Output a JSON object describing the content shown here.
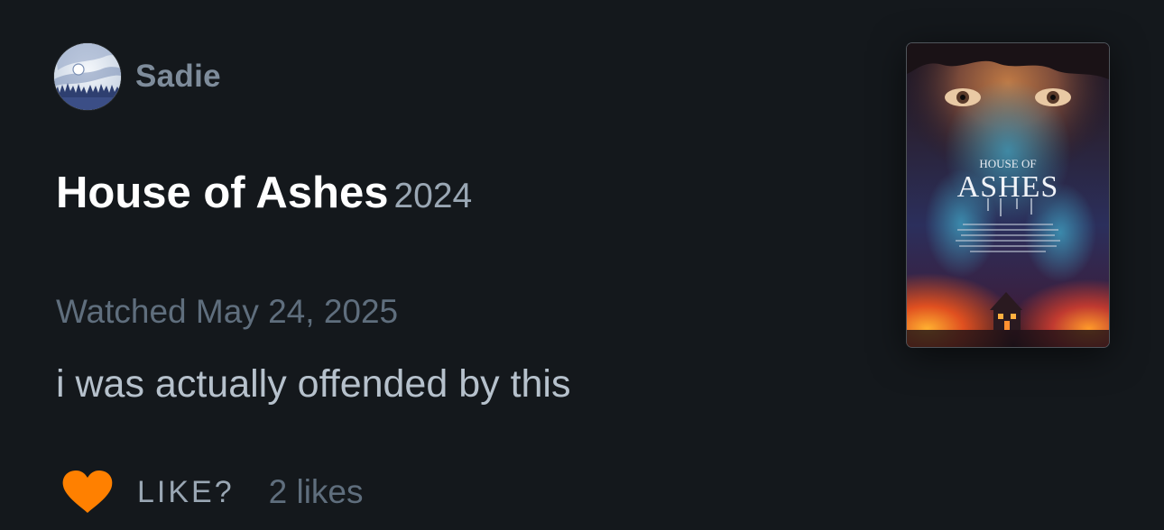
{
  "review": {
    "author": {
      "username": "Sadie",
      "avatar_icon": "avatar-moon-forest"
    },
    "film": {
      "title": "House of Ashes",
      "year": "2024",
      "poster": {
        "title_line1": "HOUSE OF",
        "title_line2": "ASHES"
      }
    },
    "watched": "Watched May 24, 2025",
    "text": "i was actually offended by this",
    "like": {
      "icon": "heart-icon",
      "icon_color": "#ff8000",
      "label": "LIKE?",
      "count": "2 likes"
    }
  },
  "colors": {
    "background": "#14181c",
    "username": "#7e8c9b",
    "year": "#9aa7b4",
    "watched": "#5f6e7d",
    "review_text": "#b6c1cc"
  }
}
